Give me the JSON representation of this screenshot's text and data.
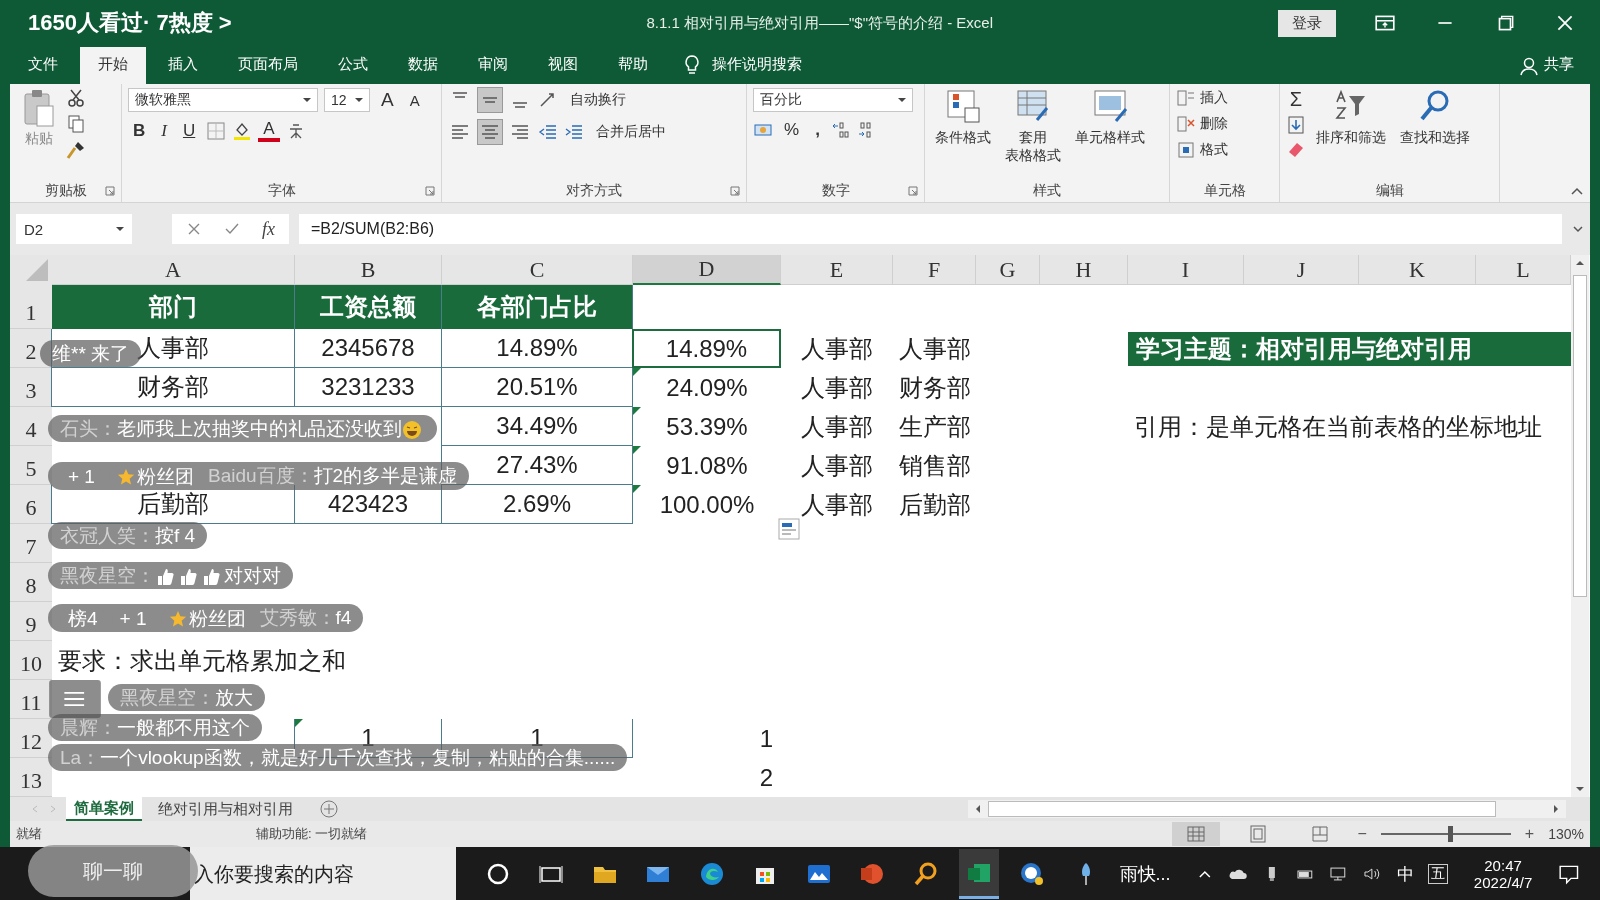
{
  "stream": {
    "viewers": "1650人看过· 7热度 >"
  },
  "window": {
    "title": "8.1.1 相对引用与绝对引用——\"$\"符号的介绍  -  Excel",
    "login": "登录"
  },
  "menu": [
    {
      "label": "文件",
      "selected": false
    },
    {
      "label": "开始",
      "selected": true
    },
    {
      "label": "插入",
      "selected": false
    },
    {
      "label": "页面布局",
      "selected": false
    },
    {
      "label": "公式",
      "selected": false
    },
    {
      "label": "数据",
      "selected": false
    },
    {
      "label": "审阅",
      "selected": false
    },
    {
      "label": "视图",
      "selected": false
    },
    {
      "label": "帮助",
      "selected": false
    }
  ],
  "tell_me": "操作说明搜索",
  "share": "共享",
  "ribbon": {
    "clipboard": {
      "paste": "粘贴",
      "label": "剪贴板"
    },
    "font": {
      "family": "微软雅黑",
      "size": "12",
      "grow": "A",
      "shrink": "A",
      "bold": "B",
      "italic": "I",
      "underline": "U",
      "color_button": "A",
      "label": "字体"
    },
    "align": {
      "vertical": [
        {
          "kind": "top",
          "pressed": false
        },
        {
          "kind": "middle",
          "pressed": true
        },
        {
          "kind": "bottom",
          "pressed": false
        }
      ],
      "horizontal": [
        {
          "kind": "left",
          "pressed": false
        },
        {
          "kind": "center",
          "pressed": true
        },
        {
          "kind": "right",
          "pressed": false
        }
      ],
      "wrap": "自动换行",
      "merge": "合并后居中",
      "label": "对齐方式"
    },
    "number": {
      "format": "百分比",
      "percent": "%",
      "comma": ",",
      "label": "数字"
    },
    "styles": {
      "buttons": [
        {
          "kind": "conditional",
          "lines": [
            "条件格式"
          ]
        },
        {
          "kind": "table",
          "lines": [
            "套用",
            "表格格式"
          ]
        },
        {
          "kind": "cell",
          "lines": [
            "单元格样式"
          ]
        }
      ],
      "label": "样式"
    },
    "cells": {
      "items": [
        {
          "kind": "insert",
          "label": "插入"
        },
        {
          "kind": "delete",
          "label": "删除"
        },
        {
          "kind": "format",
          "label": "格式"
        }
      ],
      "label": "单元格"
    },
    "editing": {
      "sum": "Σ",
      "sort": "排序和筛选",
      "find": "查找和选择",
      "label": "编辑"
    }
  },
  "formula": {
    "name_box": "D2",
    "fx": "fx",
    "formula": "=B2/SUM(B2:B6)"
  },
  "sheet": {
    "columns": [
      {
        "letter": "A",
        "selected": false
      },
      {
        "letter": "B",
        "selected": false
      },
      {
        "letter": "C",
        "selected": false
      },
      {
        "letter": "D",
        "selected": true
      },
      {
        "letter": "E",
        "selected": false
      },
      {
        "letter": "F",
        "selected": false
      },
      {
        "letter": "G",
        "selected": false
      },
      {
        "letter": "H",
        "selected": false
      },
      {
        "letter": "I",
        "selected": false
      },
      {
        "letter": "J",
        "selected": false
      },
      {
        "letter": "K",
        "selected": false
      },
      {
        "letter": "L",
        "selected": false
      }
    ],
    "rows": [
      {
        "number": "1",
        "cells": [
          {
            "text": "部门",
            "kind": "header"
          },
          {
            "text": "工资总额",
            "kind": "header"
          },
          {
            "text": "各部门占比",
            "kind": "header"
          }
        ]
      },
      {
        "number": "2",
        "cells": [
          {
            "text": "人事部",
            "kind": "table"
          },
          {
            "text": "2345678",
            "kind": "table"
          },
          {
            "text": "14.89%",
            "kind": "table"
          },
          {
            "text": "14.89%",
            "kind": "table",
            "selected": true
          },
          {
            "text": "人事部",
            "kind": "plain"
          },
          {
            "text": "人事部",
            "kind": "plain"
          },
          null,
          null,
          {
            "text": "学习主题：相对引用与绝对引用",
            "kind": "banner"
          }
        ]
      },
      {
        "number": "3",
        "cells": [
          {
            "text": "财务部",
            "kind": "table"
          },
          {
            "text": "3231233",
            "kind": "table"
          },
          {
            "text": "20.51%",
            "kind": "table"
          },
          {
            "text": "24.09%",
            "kind": "plain",
            "warning": true
          },
          {
            "text": "人事部",
            "kind": "plain"
          },
          {
            "text": "财务部",
            "kind": "plain"
          }
        ]
      },
      {
        "number": "4",
        "cells": [
          null,
          null,
          {
            "text": "34.49%",
            "kind": "table"
          },
          {
            "text": "53.39%",
            "kind": "plain",
            "warning": true
          },
          {
            "text": "人事部",
            "kind": "plain"
          },
          {
            "text": "生产部",
            "kind": "plain"
          },
          null,
          null,
          {
            "text": "引用：是单元格在当前表格的坐标地址",
            "kind": "note"
          }
        ]
      },
      {
        "number": "5",
        "cells": [
          null,
          null,
          {
            "text": "27.43%",
            "kind": "table"
          },
          {
            "text": "91.08%",
            "kind": "plain",
            "warning": true
          },
          {
            "text": "人事部",
            "kind": "plain"
          },
          {
            "text": "销售部",
            "kind": "plain"
          }
        ]
      },
      {
        "number": "6",
        "cells": [
          {
            "text": "后勤部",
            "kind": "table"
          },
          {
            "text": "423423",
            "kind": "table"
          },
          {
            "text": "2.69%",
            "kind": "table"
          },
          {
            "text": "100.00%",
            "kind": "plain",
            "warning": true
          },
          {
            "text": "人事部",
            "kind": "plain"
          },
          {
            "text": "后勤部",
            "kind": "plain"
          }
        ]
      },
      {
        "number": "7",
        "cells": []
      },
      {
        "number": "8",
        "cells": []
      },
      {
        "number": "9",
        "cells": []
      },
      {
        "number": "10",
        "cells": [
          {
            "text": "要求：求出单元格累加之和",
            "kind": "note"
          }
        ]
      },
      {
        "number": "11",
        "cells": []
      },
      {
        "number": "12",
        "cells": [
          null,
          {
            "text": "1",
            "kind": "table",
            "warning": true
          },
          {
            "text": "1",
            "kind": "table"
          },
          {
            "text": "1",
            "kind": "number"
          }
        ]
      },
      {
        "number": "13",
        "cells": [
          null,
          null,
          null,
          {
            "text": "2",
            "kind": "number"
          }
        ]
      }
    ]
  },
  "sheet_tabs": [
    {
      "label": "简单案例",
      "selected": true
    },
    {
      "label": "绝对引用与相对引用",
      "selected": false
    }
  ],
  "status": {
    "ready": "就绪",
    "accessibility": "辅助功能: 一切就绪",
    "views": [
      {
        "kind": "normal",
        "selected": true
      },
      {
        "kind": "layout",
        "selected": false
      },
      {
        "kind": "break",
        "selected": false
      }
    ],
    "zoom_out": "−",
    "level": 0.53,
    "zoom_in": "+",
    "zoom": "130%"
  },
  "chat": {
    "messages": [
      {
        "parts": [
          {
            "kind": "text",
            "text": "维** 来了"
          }
        ]
      },
      {
        "name": "石头：",
        "parts": [
          {
            "kind": "text",
            "text": "老师我上次抽奖中的礼品还没收到"
          },
          {
            "kind": "laugh"
          }
        ]
      },
      {
        "badges": [
          {
            "kind": "plus",
            "text": "+ 1"
          },
          {
            "kind": "fans",
            "text": "粉丝团"
          }
        ],
        "name": "Baidu百度：",
        "parts": [
          {
            "kind": "text",
            "text": "打2的多半是谦虚"
          }
        ]
      },
      {
        "name": "衣冠人笑：",
        "parts": [
          {
            "kind": "text",
            "text": "按f 4"
          }
        ]
      },
      {
        "name": "黑夜星空：",
        "parts": [
          {
            "kind": "thumb"
          },
          {
            "kind": "thumb"
          },
          {
            "kind": "thumb"
          },
          {
            "kind": "text",
            "text": "对对对"
          }
        ]
      },
      {
        "badges": [
          {
            "kind": "rank",
            "text": "榜4"
          },
          {
            "kind": "plus",
            "text": "+ 1"
          },
          {
            "kind": "fans",
            "text": "粉丝团"
          }
        ],
        "name": "艾秀敏：",
        "parts": [
          {
            "kind": "text",
            "text": "f4"
          }
        ]
      },
      {
        "name": "黑夜星空：",
        "parts": [
          {
            "kind": "text",
            "text": "放大"
          }
        ]
      },
      {
        "name": "晨辉：",
        "parts": [
          {
            "kind": "text",
            "text": "一般都不用这个"
          }
        ]
      },
      {
        "name": "La：",
        "parts": [
          {
            "kind": "text",
            "text": "一个vlookup函数，就是好几千次查找，复制，粘贴的合集......"
          }
        ]
      }
    ],
    "chat_button": "聊一聊"
  },
  "taskbar": {
    "search": "入你要搜索的内容",
    "apps": [
      {
        "kind": "cortana",
        "selected": false
      },
      {
        "kind": "taskview",
        "selected": false
      },
      {
        "kind": "explorer",
        "selected": false
      },
      {
        "kind": "mail",
        "selected": false
      },
      {
        "kind": "edge",
        "selected": false
      },
      {
        "kind": "store",
        "selected": false
      },
      {
        "kind": "photos",
        "selected": false
      },
      {
        "kind": "powerpoint",
        "selected": false
      },
      {
        "kind": "search",
        "selected": false
      },
      {
        "kind": "excel",
        "selected": true
      },
      {
        "kind": "help",
        "selected": false
      },
      {
        "kind": "umbrella",
        "selected": false
      }
    ],
    "tray_app": "雨快...",
    "ime": "中",
    "ime_mode": "五",
    "time": "20:47",
    "date": "2022/4/7"
  }
}
